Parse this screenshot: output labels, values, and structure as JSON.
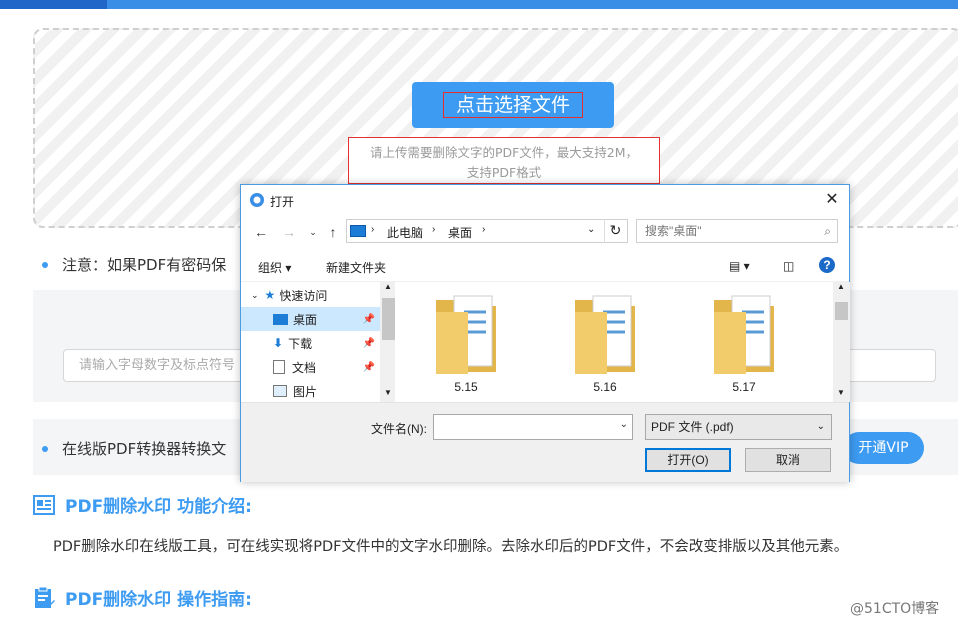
{
  "page": {
    "upload": {
      "select_button": "点击选择文件",
      "hint_line1": "请上传需要删除文字的PDF文件，最大支持2M，",
      "hint_line2": "支持PDF格式"
    },
    "note_text": "注意：如果PDF有密码保",
    "watermark_input_placeholder": "请输入字母数字及标点符号",
    "converter_text": "在线版PDF转换器转换文",
    "vip_button": "开通VIP",
    "section1_title": "PDF删除水印 功能介绍:",
    "section1_text": "PDF删除水印在线版工具，可在线实现将PDF文件中的文字水印删除。去除水印后的PDF文件，不会改变排版以及其他元素。",
    "section2_title": "PDF删除水印 操作指南:",
    "brand_watermark": "@51CTO博客"
  },
  "dialog": {
    "title": "打开",
    "address": {
      "crumb1": "此电脑",
      "crumb2": "桌面"
    },
    "search_placeholder": "搜索\"桌面\"",
    "toolbar": {
      "organize": "组织",
      "new_folder": "新建文件夹"
    },
    "nav_items": [
      {
        "label": "快速访问",
        "icon": "star-icon"
      },
      {
        "label": "桌面",
        "icon": "desktop-icon"
      },
      {
        "label": "下载",
        "icon": "download-icon"
      },
      {
        "label": "文档",
        "icon": "document-icon"
      },
      {
        "label": "图片",
        "icon": "picture-icon"
      }
    ],
    "files": [
      {
        "name": "5.15"
      },
      {
        "name": "5.16"
      },
      {
        "name": "5.17"
      }
    ],
    "filename_label": "文件名(N):",
    "filename_value": "",
    "filetype": "PDF 文件 (.pdf)",
    "open_button": "打开(O)",
    "cancel_button": "取消"
  },
  "colors": {
    "accent": "#3d9bf2",
    "highlight_border": "#e53030",
    "dialog_border": "#4a9be0"
  }
}
